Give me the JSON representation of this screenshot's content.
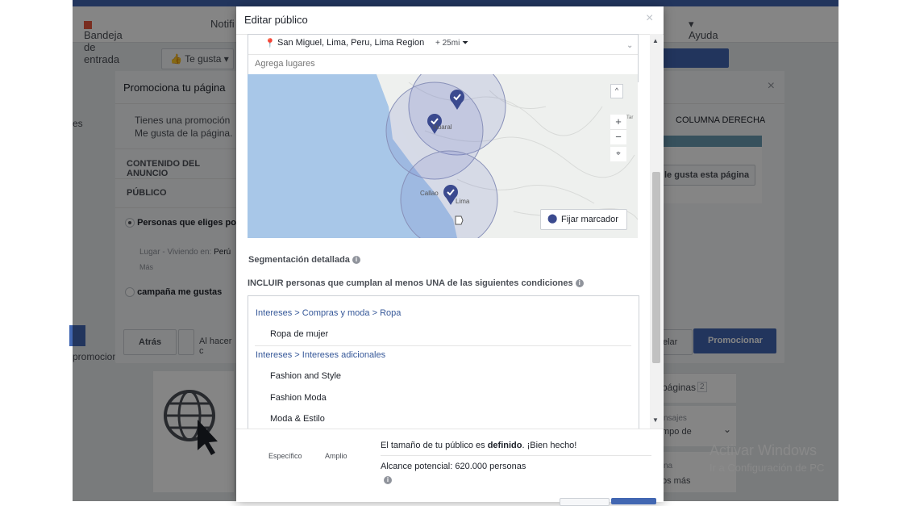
{
  "background": {
    "nav": {
      "inbox": "Bandeja de entrada",
      "notif": "Notifi",
      "help": "Ayuda"
    },
    "like_button": "Te gusta",
    "left_es": "es",
    "promo_left": "promocion"
  },
  "behind_modal": {
    "title": "Promociona tu página",
    "intro_line1": "Tienes una promoción",
    "intro_line2": "Me gusta de la página.",
    "sections": [
      "CONTENIDO DEL ANUNCIO",
      "PÚBLICO"
    ],
    "radio1": "Personas que eliges po",
    "place_label": "Lugar - Viviendo en:",
    "place_value": "Perú",
    "more": "Más",
    "radio2": "campaña me gustas",
    "right_header": "COLUMNA DERECHA",
    "like_page_btn": "le gusta esta página",
    "back_btn": "Atrás",
    "terms": "Al hacer c",
    "cancel_partial": "elar",
    "promote_btn": "Promocionar"
  },
  "side_panel": {
    "pages": "páginas",
    "pages_count": "2",
    "messages": "nsajes",
    "time": "mpo de",
    "na": "na",
    "more": "os más"
  },
  "watermark": {
    "line1": "Activar Windows",
    "line2": "Ir a Configuración de PC"
  },
  "modal": {
    "title": "Editar público",
    "close": "×",
    "location": {
      "name": "San Miguel, Lima, Peru, Lima Region",
      "radius": "+ 25mi",
      "add_placeholder": "Agrega lugares"
    },
    "map": {
      "pin_button": "Fijar marcador",
      "labels": [
        "Callao",
        "Lima",
        "Huaral",
        "Tar"
      ],
      "zoom_in": "+",
      "zoom_out": "−",
      "collapse": "^"
    },
    "detailed_targeting": "Segmentación detallada",
    "include_text": "INCLUIR personas que cumplan al menos UNA de las siguientes condiciones",
    "groups": [
      {
        "path": "Intereses > Compras y moda > Ropa",
        "items": [
          "Ropa de mujer"
        ]
      },
      {
        "path": "Intereses > Intereses adicionales",
        "items": [
          "Fashion and Style",
          "Fashion Moda",
          "Moda & Estilo"
        ]
      }
    ],
    "footer": {
      "specific": "Específico",
      "broad": "Amplio",
      "size_prefix": "El tamaño de tu público es ",
      "size_bold": "definido",
      "size_suffix": ". ¡Bien hecho!",
      "reach": "Alcance potencial: 620.000 personas"
    }
  },
  "colors": {
    "accent": "#4267b2",
    "link": "#365899",
    "pin": "#3b4a8f"
  }
}
